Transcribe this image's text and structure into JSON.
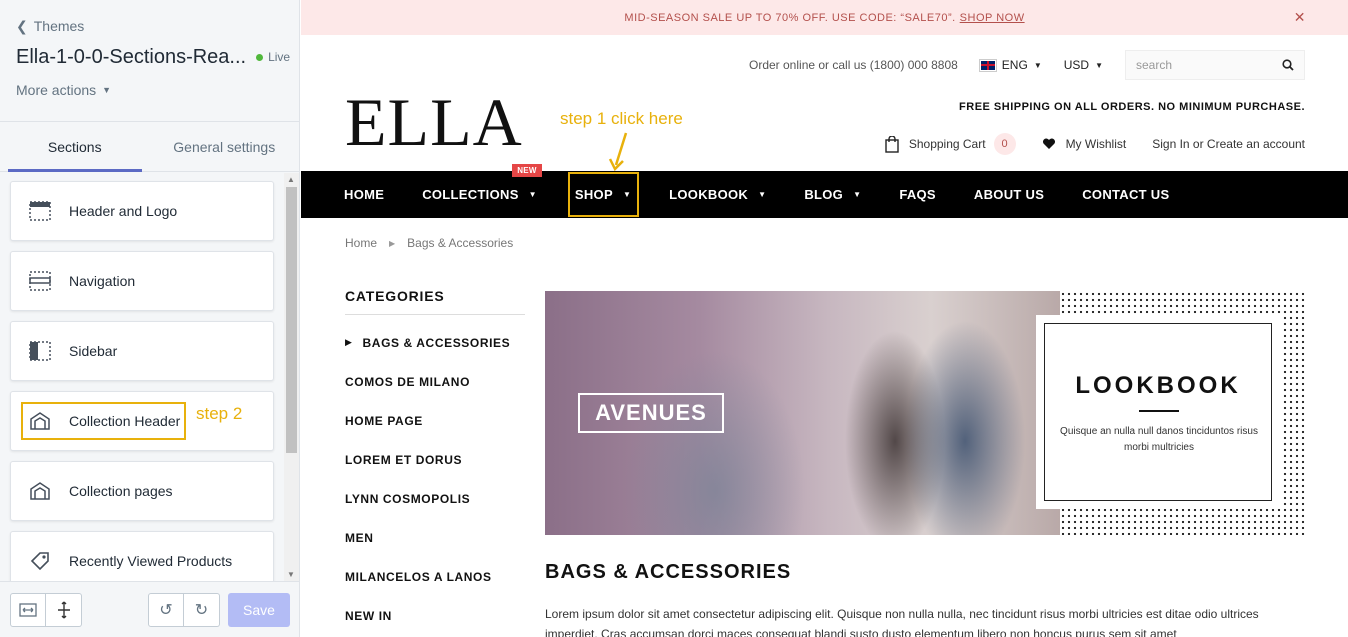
{
  "sidebar": {
    "back_label": "Themes",
    "theme_name": "Ella-1-0-0-Sections-Rea...",
    "live_label": "Live",
    "more_actions": "More actions",
    "tabs": [
      {
        "label": "Sections"
      },
      {
        "label": "General settings"
      }
    ],
    "items": [
      {
        "label": "Header and Logo",
        "icon": "header-icon"
      },
      {
        "label": "Navigation",
        "icon": "navigation-icon"
      },
      {
        "label": "Sidebar",
        "icon": "sidebar-icon"
      },
      {
        "label": "Collection Header",
        "icon": "collection-icon"
      },
      {
        "label": "Collection pages",
        "icon": "collection-icon"
      },
      {
        "label": "Recently Viewed Products",
        "icon": "tag-icon"
      }
    ],
    "step2_label": "step 2",
    "save_label": "Save"
  },
  "store": {
    "announcement": "MID-SEASON SALE UP TO 70% OFF. USE CODE: “SALE70”.",
    "announcement_link": "SHOP NOW",
    "phone": "Order online or call us (1800) 000 8808",
    "language": "ENG",
    "currency": "USD",
    "search_placeholder": "search",
    "logo": "ELLA",
    "step1_label": "step 1 click here",
    "free_shipping": "FREE SHIPPING ON ALL ORDERS. NO MINIMUM PURCHASE.",
    "cart_label": "Shopping Cart",
    "cart_count": "0",
    "wishlist_label": "My Wishlist",
    "account_label": "Sign In or Create an account",
    "nav": [
      {
        "label": "HOME"
      },
      {
        "label": "COLLECTIONS",
        "badge": "NEW"
      },
      {
        "label": "SHOP"
      },
      {
        "label": "LOOKBOOK"
      },
      {
        "label": "BLOG"
      },
      {
        "label": "FAQS"
      },
      {
        "label": "ABOUT US"
      },
      {
        "label": "CONTACT US"
      }
    ],
    "breadcrumb": [
      "Home",
      "Bags & Accessories"
    ],
    "categories_title": "CATEGORIES",
    "categories": [
      "BAGS & ACCESSORIES",
      "COMOS DE MILANO",
      "HOME PAGE",
      "LOREM ET DORUS",
      "LYNN COSMOPOLIS",
      "MEN",
      "MILANCELOS A LANOS",
      "NEW IN"
    ],
    "banner_label": "AVENUES",
    "lookbook_title": "LOOKBOOK",
    "lookbook_text": "Quisque an nulla null danos tinciduntos risus morbi multricies",
    "section_title": "BAGS & ACCESSORIES",
    "section_desc": "Lorem ipsum dolor sit amet consectetur adipiscing elit. Quisque non nulla nulla, nec tincidunt risus morbi ultricies est ditae odio ultrices imperdiet. Cras accumsan dorci maces consequat blandi susto dusto elementum libero non honcus purus sem sit amet"
  },
  "colors": {
    "accent": "#5c6ac4",
    "highlight": "#e8b10c",
    "nav_bg": "#000000",
    "announce_bg": "#fde8e8",
    "live": "#50b83c",
    "badge": "#e54646"
  }
}
